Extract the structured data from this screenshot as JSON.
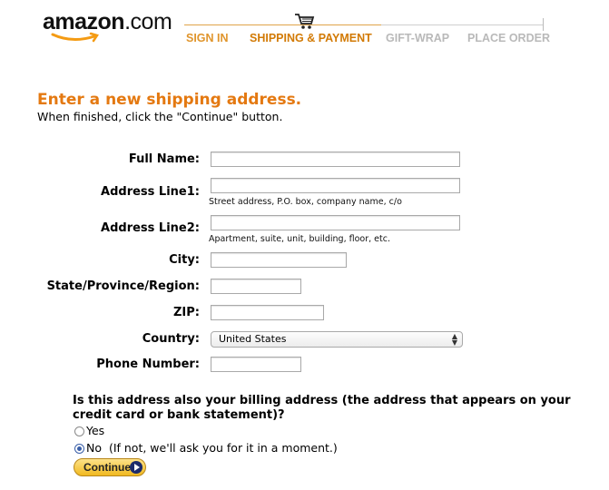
{
  "header": {
    "logo_word": "amazon",
    "logo_suffix": ".com",
    "steps": [
      {
        "label": "SIGN IN",
        "state": "done"
      },
      {
        "label": "SHIPPING & PAYMENT",
        "state": "current"
      },
      {
        "label": "GIFT-WRAP",
        "state": "todo"
      },
      {
        "label": "PLACE ORDER",
        "state": "todo"
      }
    ],
    "icons": {
      "logo_smile": "smile-arrow",
      "progress": "cart-icon"
    },
    "colors": {
      "accent": "#e47911",
      "step_done": "#e0952c",
      "step_todo": "#b9b9b9"
    }
  },
  "page": {
    "title": "Enter a new shipping address.",
    "subtitle": "When finished, click the \"Continue\" button."
  },
  "form": {
    "full_name": {
      "label": "Full Name:",
      "value": ""
    },
    "address1": {
      "label": "Address Line1:",
      "value": "",
      "hint": "Street address, P.O. box, company name, c/o"
    },
    "address2": {
      "label": "Address Line2:",
      "value": "",
      "hint": "Apartment, suite, unit, building, floor, etc."
    },
    "city": {
      "label": "City:",
      "value": ""
    },
    "state": {
      "label": "State/Province/Region:",
      "value": ""
    },
    "zip": {
      "label": "ZIP:",
      "value": ""
    },
    "country": {
      "label": "Country:",
      "selected": "United States"
    },
    "phone": {
      "label": "Phone Number:",
      "value": ""
    }
  },
  "billing": {
    "question": "Is this address also your billing address (the address that appears on your credit card or bank statement)?",
    "options": [
      {
        "label": "Yes",
        "checked": false
      },
      {
        "label": "No  (If not, we'll ask you for it in a moment.)",
        "checked": true
      }
    ],
    "continue_label": "Continue"
  }
}
